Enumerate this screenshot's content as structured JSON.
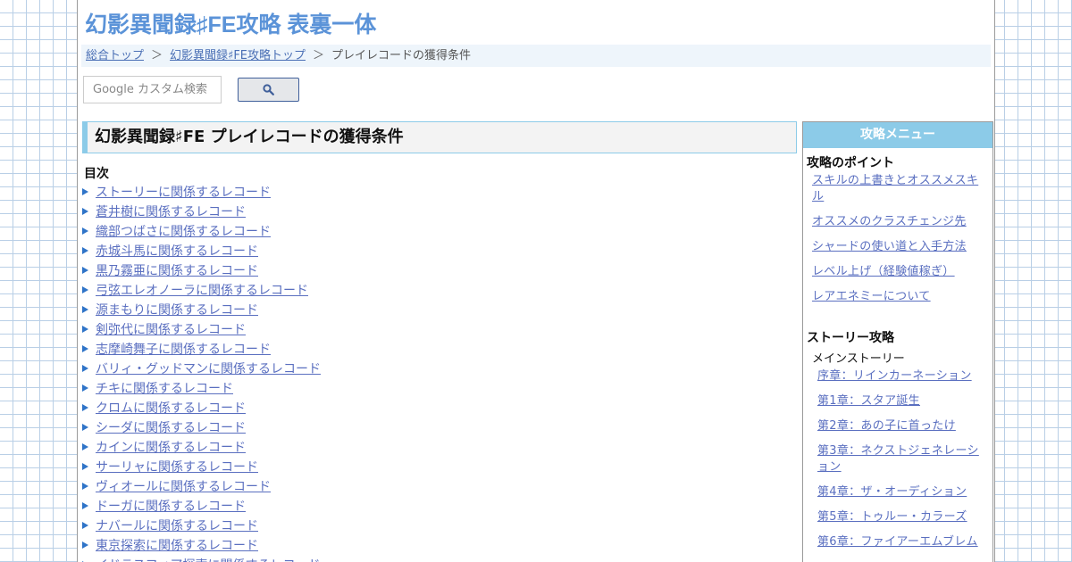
{
  "site_title": "幻影異聞録♯FE攻略 表裏一体",
  "breadcrumb": {
    "items": [
      "総合トップ",
      "幻影異聞録♯FE攻略トップ"
    ],
    "separator": "＞",
    "current": "プレイレコードの獲得条件"
  },
  "search": {
    "placeholder": "Google カスタム検索",
    "button_icon": "search-icon"
  },
  "main": {
    "heading": "幻影異聞録♯FE プレイレコードの獲得条件",
    "toc_title": "目次",
    "toc_items": [
      "ストーリーに関係するレコード",
      "蒼井樹に関係するレコード",
      "織部つばさに関係するレコード",
      "赤城斗馬に関係するレコード",
      "黒乃霧亜に関係するレコード",
      "弓弦エレオノーラに関係するレコード",
      "源まもりに関係するレコード",
      "剣弥代に関係するレコード",
      "志摩崎舞子に関係するレコード",
      "バリィ・グッドマンに関係するレコード",
      "チキに関係するレコード",
      "クロムに関係するレコード",
      "シーダに関係するレコード",
      "カインに関係するレコード",
      "サーリャに関係するレコード",
      "ヴィオールに関係するレコード",
      "ドーガに関係するレコード",
      "ナバールに関係するレコード",
      "東京探索に関係するレコード",
      "イドラスフィア探索に関係するレコード"
    ]
  },
  "sidebar": {
    "header": "攻略メニュー",
    "sections": [
      {
        "title": "攻略のポイント",
        "links": [
          "スキルの上書きとオススメスキル",
          "オススメのクラスチェンジ先",
          "シャードの使い道と入手方法",
          "レベル上げ（経験値稼ぎ）",
          "レアエネミーについて"
        ]
      },
      {
        "title": "ストーリー攻略",
        "subtitle": "メインストーリー",
        "links": [
          "序章：リインカーネーション",
          "第1章：スタア誕生",
          "第2章：あの子に首ったけ",
          "第3章：ネクストジェネレーション",
          "第4章：ザ・オーディション",
          "第5章：トゥルー・カラーズ",
          "第6章：ファイアーエムブレム"
        ]
      }
    ]
  },
  "colors": {
    "title": "#5b93d8",
    "link": "#5a6fc0",
    "accent": "#8ccbe8",
    "bullet": "#2f74c8"
  }
}
